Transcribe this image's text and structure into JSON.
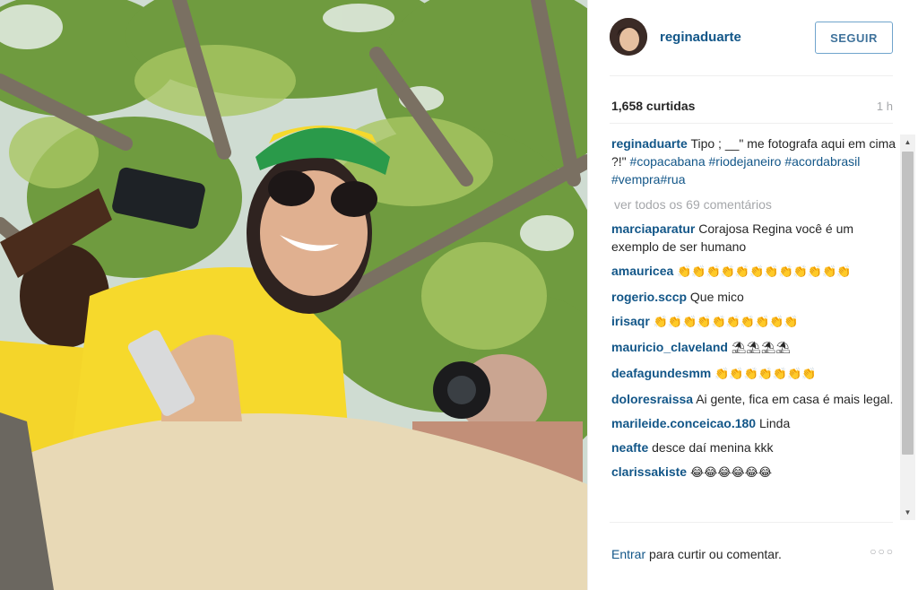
{
  "post": {
    "username": "reginaduarte",
    "follow_label": "SEGUIR",
    "likes": "1,658 curtidas",
    "time": "1 h"
  },
  "caption": {
    "user": "reginaduarte",
    "text": "Tipo ; __\" me fotografa aqui em cima ?!\"",
    "tags": [
      "#copacabana",
      "#riodejaneiro",
      "#acordabrasil",
      "#vempra",
      "#rua"
    ]
  },
  "view_all": "ver todos os 69 comentários",
  "comments": [
    {
      "user": "marciaparatur",
      "text": "Corajosa Regina você é um exemplo de ser humano"
    },
    {
      "user": "amauricea",
      "text": "👏👏👏👏👏👏👏👏👏👏👏👏"
    },
    {
      "user": "rogerio.sccp",
      "text": "Que mico"
    },
    {
      "user": "irisaqr",
      "text": "👏👏👏👏👏👏👏👏👏👏"
    },
    {
      "user": "mauricio_claveland",
      "text": "⛱⛱⛱⛱"
    },
    {
      "user": "deafagundesmm",
      "text": "👏👏👏👏👏👏👏"
    },
    {
      "user": "doloresraissa",
      "text": "Ai gente, fica em casa é mais legal."
    },
    {
      "user": "marileide.conceicao.180",
      "text": "Linda"
    },
    {
      "user": "neafte",
      "text": "desce daí menina kkk"
    },
    {
      "user": "clarissakiste",
      "text": "😂😂😂😂😂😂"
    }
  ],
  "footer": {
    "login": "Entrar",
    "rest": " para curtir ou comentar.",
    "more": "○○○"
  },
  "scroll": {
    "up": "▲",
    "down": "▼"
  },
  "colors": {
    "link": "#125688",
    "follow_border": "#70a4cc",
    "muted": "#a5a7aa",
    "shirt_yellow": "#f6d92c",
    "cap_green": "#2a9a4a"
  }
}
